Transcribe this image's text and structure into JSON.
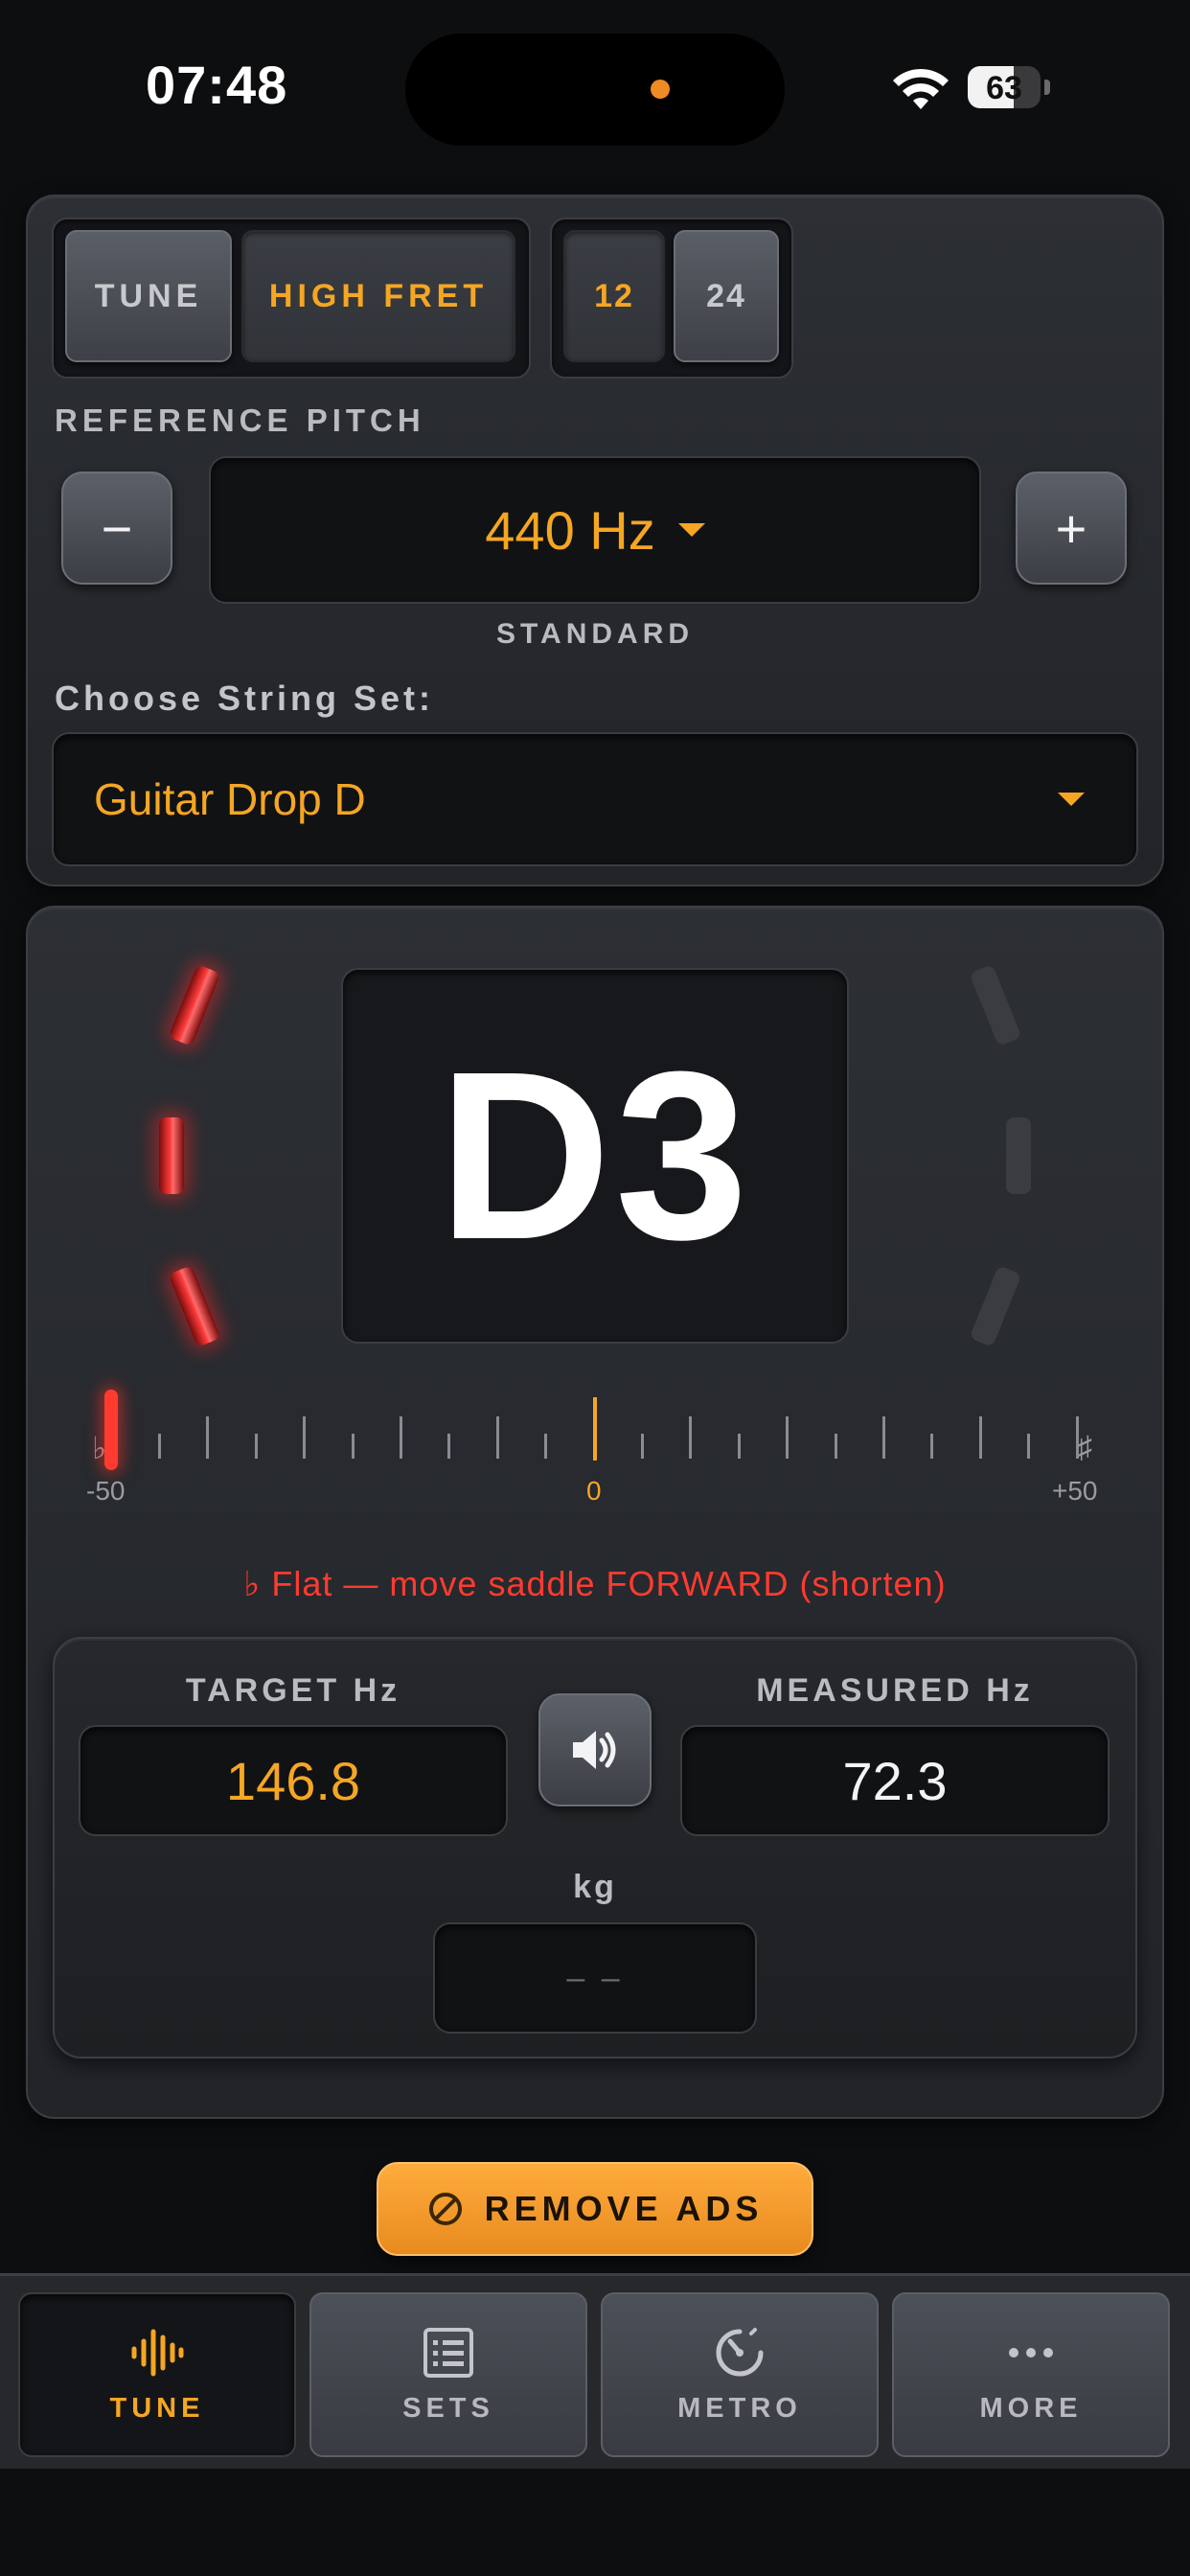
{
  "status_bar": {
    "time": "07:48",
    "battery_level": "63",
    "battery_fraction": 0.63
  },
  "mode_segment": {
    "options": [
      "TUNE",
      "HIGH FRET"
    ],
    "selected": "HIGH FRET"
  },
  "fret_segment": {
    "options": [
      "12",
      "24"
    ],
    "selected": "12"
  },
  "reference_pitch": {
    "label": "REFERENCE PITCH",
    "minus_label": "−",
    "plus_label": "+",
    "value": "440 Hz",
    "caption": "STANDARD"
  },
  "string_set": {
    "label": "Choose String Set:",
    "value": "Guitar Drop D"
  },
  "tuner": {
    "note": "D3",
    "scale_min_label": "-50",
    "scale_center_label": "0",
    "scale_max_label": "+50",
    "flat_symbol": "♭",
    "sharp_symbol": "♯",
    "needle_cents": -50,
    "flat_leds_lit": 3,
    "sharp_leds_lit": 0,
    "message": "♭ Flat — move saddle FORWARD (shorten)",
    "accent_color": "#f5a623",
    "flat_color": "#ff3b30"
  },
  "readouts": {
    "target_label": "TARGET Hz",
    "target_value": "146.8",
    "measured_label": "MEASURED Hz",
    "measured_value": "72.3",
    "kg_label": "kg",
    "kg_value": "– –",
    "speaker_icon": "speaker-icon"
  },
  "ads_button": {
    "label": "REMOVE ADS",
    "icon": "no-ads-icon"
  },
  "tab_bar": {
    "tabs": [
      {
        "label": "TUNE",
        "icon": "waveform-icon",
        "active": true
      },
      {
        "label": "SETS",
        "icon": "list-icon",
        "active": false
      },
      {
        "label": "METRO",
        "icon": "metronome-icon",
        "active": false
      },
      {
        "label": "MORE",
        "icon": "more-icon",
        "active": false
      }
    ]
  }
}
